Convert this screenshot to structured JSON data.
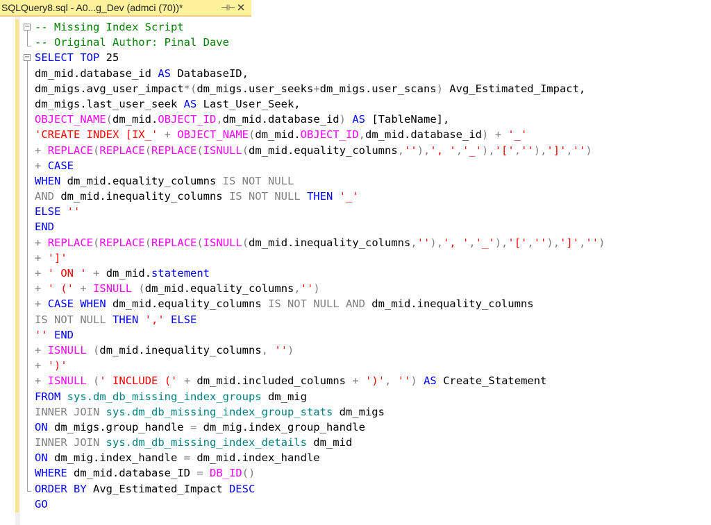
{
  "tab": {
    "title": "SQLQuery8.sql - A0...g_Dev (admci (70))*",
    "pin_icon": "pin-icon",
    "close_icon": "close-icon",
    "pin_glyph": "⊣⊢",
    "close_glyph": "✕"
  },
  "editor": {
    "fold_glyph": "−",
    "lines": [
      [
        {
          "c": "cm",
          "t": "-- Missing Index Script"
        }
      ],
      [
        {
          "c": "cm",
          "t": "-- Original Author: Pinal Dave"
        }
      ],
      [
        {
          "c": "kw",
          "t": "SELECT TOP "
        },
        {
          "c": "pl",
          "t": "25"
        }
      ],
      [
        {
          "c": "pl",
          "t": "dm_mid.database_id "
        },
        {
          "c": "kw",
          "t": "AS"
        },
        {
          "c": "pl",
          "t": " DatabaseID,"
        }
      ],
      [
        {
          "c": "pl",
          "t": "dm_migs.avg_user_impact"
        },
        {
          "c": "gr",
          "t": "*("
        },
        {
          "c": "pl",
          "t": "dm_migs.user_seeks"
        },
        {
          "c": "gr",
          "t": "+"
        },
        {
          "c": "pl",
          "t": "dm_migs.user_scans"
        },
        {
          "c": "gr",
          "t": ")"
        },
        {
          "c": "pl",
          "t": " Avg_Estimated_Impact,"
        }
      ],
      [
        {
          "c": "pl",
          "t": "dm_migs.last_user_seek "
        },
        {
          "c": "kw",
          "t": "AS"
        },
        {
          "c": "pl",
          "t": " Last_User_Seek,"
        }
      ],
      [
        {
          "c": "fn",
          "t": "OBJECT_NAME"
        },
        {
          "c": "gr",
          "t": "("
        },
        {
          "c": "pl",
          "t": "dm_mid."
        },
        {
          "c": "fn",
          "t": "OBJECT_ID"
        },
        {
          "c": "gr",
          "t": ","
        },
        {
          "c": "pl",
          "t": "dm_mid.database_id"
        },
        {
          "c": "gr",
          "t": ")"
        },
        {
          "c": "pl",
          "t": " "
        },
        {
          "c": "kw",
          "t": "AS"
        },
        {
          "c": "pl",
          "t": " [TableName],"
        }
      ],
      [
        {
          "c": "st",
          "t": "'CREATE INDEX [IX_'"
        },
        {
          "c": "pl",
          "t": " "
        },
        {
          "c": "gr",
          "t": "+"
        },
        {
          "c": "pl",
          "t": " "
        },
        {
          "c": "fn",
          "t": "OBJECT_NAME"
        },
        {
          "c": "gr",
          "t": "("
        },
        {
          "c": "pl",
          "t": "dm_mid."
        },
        {
          "c": "fn",
          "t": "OBJECT_ID"
        },
        {
          "c": "gr",
          "t": ","
        },
        {
          "c": "pl",
          "t": "dm_mid.database_id"
        },
        {
          "c": "gr",
          "t": ")"
        },
        {
          "c": "pl",
          "t": " "
        },
        {
          "c": "gr",
          "t": "+"
        },
        {
          "c": "pl",
          "t": " "
        },
        {
          "c": "st",
          "t": "'_'"
        }
      ],
      [
        {
          "c": "gr",
          "t": "+"
        },
        {
          "c": "pl",
          "t": " "
        },
        {
          "c": "fn",
          "t": "REPLACE"
        },
        {
          "c": "gr",
          "t": "("
        },
        {
          "c": "fn",
          "t": "REPLACE"
        },
        {
          "c": "gr",
          "t": "("
        },
        {
          "c": "fn",
          "t": "REPLACE"
        },
        {
          "c": "gr",
          "t": "("
        },
        {
          "c": "fn",
          "t": "ISNULL"
        },
        {
          "c": "gr",
          "t": "("
        },
        {
          "c": "pl",
          "t": "dm_mid.equality_columns"
        },
        {
          "c": "gr",
          "t": ","
        },
        {
          "c": "st",
          "t": "''"
        },
        {
          "c": "gr",
          "t": "),"
        },
        {
          "c": "st",
          "t": "', '"
        },
        {
          "c": "gr",
          "t": ","
        },
        {
          "c": "st",
          "t": "'_'"
        },
        {
          "c": "gr",
          "t": "),"
        },
        {
          "c": "st",
          "t": "'['"
        },
        {
          "c": "gr",
          "t": ","
        },
        {
          "c": "st",
          "t": "''"
        },
        {
          "c": "gr",
          "t": "),"
        },
        {
          "c": "st",
          "t": "']'"
        },
        {
          "c": "gr",
          "t": ","
        },
        {
          "c": "st",
          "t": "''"
        },
        {
          "c": "gr",
          "t": ")"
        }
      ],
      [
        {
          "c": "gr",
          "t": "+"
        },
        {
          "c": "pl",
          "t": " "
        },
        {
          "c": "kw",
          "t": "CASE"
        }
      ],
      [
        {
          "c": "kw",
          "t": "WHEN"
        },
        {
          "c": "pl",
          "t": " dm_mid.equality_columns "
        },
        {
          "c": "gr",
          "t": "IS NOT NULL"
        }
      ],
      [
        {
          "c": "gr",
          "t": "AND"
        },
        {
          "c": "pl",
          "t": " dm_mid.inequality_columns "
        },
        {
          "c": "gr",
          "t": "IS NOT NULL"
        },
        {
          "c": "pl",
          "t": " "
        },
        {
          "c": "kw",
          "t": "THEN"
        },
        {
          "c": "pl",
          "t": " "
        },
        {
          "c": "st",
          "t": "'_'"
        }
      ],
      [
        {
          "c": "kw",
          "t": "ELSE"
        },
        {
          "c": "pl",
          "t": " "
        },
        {
          "c": "st",
          "t": "''"
        }
      ],
      [
        {
          "c": "kw",
          "t": "END"
        }
      ],
      [
        {
          "c": "gr",
          "t": "+"
        },
        {
          "c": "pl",
          "t": " "
        },
        {
          "c": "fn",
          "t": "REPLACE"
        },
        {
          "c": "gr",
          "t": "("
        },
        {
          "c": "fn",
          "t": "REPLACE"
        },
        {
          "c": "gr",
          "t": "("
        },
        {
          "c": "fn",
          "t": "REPLACE"
        },
        {
          "c": "gr",
          "t": "("
        },
        {
          "c": "fn",
          "t": "ISNULL"
        },
        {
          "c": "gr",
          "t": "("
        },
        {
          "c": "pl",
          "t": "dm_mid.inequality_columns"
        },
        {
          "c": "gr",
          "t": ","
        },
        {
          "c": "st",
          "t": "''"
        },
        {
          "c": "gr",
          "t": "),"
        },
        {
          "c": "st",
          "t": "', '"
        },
        {
          "c": "gr",
          "t": ","
        },
        {
          "c": "st",
          "t": "'_'"
        },
        {
          "c": "gr",
          "t": "),"
        },
        {
          "c": "st",
          "t": "'['"
        },
        {
          "c": "gr",
          "t": ","
        },
        {
          "c": "st",
          "t": "''"
        },
        {
          "c": "gr",
          "t": "),"
        },
        {
          "c": "st",
          "t": "']'"
        },
        {
          "c": "gr",
          "t": ","
        },
        {
          "c": "st",
          "t": "''"
        },
        {
          "c": "gr",
          "t": ")"
        }
      ],
      [
        {
          "c": "gr",
          "t": "+"
        },
        {
          "c": "pl",
          "t": " "
        },
        {
          "c": "st",
          "t": "']'"
        }
      ],
      [
        {
          "c": "gr",
          "t": "+"
        },
        {
          "c": "pl",
          "t": " "
        },
        {
          "c": "st",
          "t": "' ON '"
        },
        {
          "c": "pl",
          "t": " "
        },
        {
          "c": "gr",
          "t": "+"
        },
        {
          "c": "pl",
          "t": " dm_mid."
        },
        {
          "c": "kw",
          "t": "statement"
        }
      ],
      [
        {
          "c": "gr",
          "t": "+"
        },
        {
          "c": "pl",
          "t": " "
        },
        {
          "c": "st",
          "t": "' ('"
        },
        {
          "c": "pl",
          "t": " "
        },
        {
          "c": "gr",
          "t": "+"
        },
        {
          "c": "pl",
          "t": " "
        },
        {
          "c": "fn",
          "t": "ISNULL"
        },
        {
          "c": "pl",
          "t": " "
        },
        {
          "c": "gr",
          "t": "("
        },
        {
          "c": "pl",
          "t": "dm_mid.equality_columns"
        },
        {
          "c": "gr",
          "t": ","
        },
        {
          "c": "st",
          "t": "''"
        },
        {
          "c": "gr",
          "t": ")"
        }
      ],
      [
        {
          "c": "gr",
          "t": "+"
        },
        {
          "c": "pl",
          "t": " "
        },
        {
          "c": "kw",
          "t": "CASE WHEN"
        },
        {
          "c": "pl",
          "t": " dm_mid.equality_columns "
        },
        {
          "c": "gr",
          "t": "IS NOT NULL AND"
        },
        {
          "c": "pl",
          "t": " dm_mid.inequality_columns"
        }
      ],
      [
        {
          "c": "gr",
          "t": "IS NOT NULL"
        },
        {
          "c": "pl",
          "t": " "
        },
        {
          "c": "kw",
          "t": "THEN"
        },
        {
          "c": "pl",
          "t": " "
        },
        {
          "c": "st",
          "t": "','"
        },
        {
          "c": "pl",
          "t": " "
        },
        {
          "c": "kw",
          "t": "ELSE"
        }
      ],
      [
        {
          "c": "st",
          "t": "''"
        },
        {
          "c": "pl",
          "t": " "
        },
        {
          "c": "kw",
          "t": "END"
        }
      ],
      [
        {
          "c": "gr",
          "t": "+"
        },
        {
          "c": "pl",
          "t": " "
        },
        {
          "c": "fn",
          "t": "ISNULL"
        },
        {
          "c": "pl",
          "t": " "
        },
        {
          "c": "gr",
          "t": "("
        },
        {
          "c": "pl",
          "t": "dm_mid.inequality_columns"
        },
        {
          "c": "gr",
          "t": ","
        },
        {
          "c": "pl",
          "t": " "
        },
        {
          "c": "st",
          "t": "''"
        },
        {
          "c": "gr",
          "t": ")"
        }
      ],
      [
        {
          "c": "gr",
          "t": "+"
        },
        {
          "c": "pl",
          "t": " "
        },
        {
          "c": "st",
          "t": "')'"
        }
      ],
      [
        {
          "c": "gr",
          "t": "+"
        },
        {
          "c": "pl",
          "t": " "
        },
        {
          "c": "fn",
          "t": "ISNULL"
        },
        {
          "c": "pl",
          "t": " "
        },
        {
          "c": "gr",
          "t": "("
        },
        {
          "c": "st",
          "t": "' INCLUDE ('"
        },
        {
          "c": "pl",
          "t": " "
        },
        {
          "c": "gr",
          "t": "+"
        },
        {
          "c": "pl",
          "t": " dm_mid.included_columns "
        },
        {
          "c": "gr",
          "t": "+"
        },
        {
          "c": "pl",
          "t": " "
        },
        {
          "c": "st",
          "t": "')'"
        },
        {
          "c": "gr",
          "t": ","
        },
        {
          "c": "pl",
          "t": " "
        },
        {
          "c": "st",
          "t": "''"
        },
        {
          "c": "gr",
          "t": ")"
        },
        {
          "c": "pl",
          "t": " "
        },
        {
          "c": "kw",
          "t": "AS"
        },
        {
          "c": "pl",
          "t": " Create_Statement"
        }
      ],
      [
        {
          "c": "kw",
          "t": "FROM"
        },
        {
          "c": "pl",
          "t": " "
        },
        {
          "c": "sy",
          "t": "sys.dm_db_missing_index_groups"
        },
        {
          "c": "pl",
          "t": " dm_mig"
        }
      ],
      [
        {
          "c": "gr",
          "t": "INNER JOIN"
        },
        {
          "c": "pl",
          "t": " "
        },
        {
          "c": "sy",
          "t": "sys.dm_db_missing_index_group_stats"
        },
        {
          "c": "pl",
          "t": " dm_migs"
        }
      ],
      [
        {
          "c": "kw",
          "t": "ON"
        },
        {
          "c": "pl",
          "t": " dm_migs.group_handle "
        },
        {
          "c": "gr",
          "t": "="
        },
        {
          "c": "pl",
          "t": " dm_mig.index_group_handle"
        }
      ],
      [
        {
          "c": "gr",
          "t": "INNER JOIN"
        },
        {
          "c": "pl",
          "t": " "
        },
        {
          "c": "sy",
          "t": "sys.dm_db_missing_index_details"
        },
        {
          "c": "pl",
          "t": " dm_mid"
        }
      ],
      [
        {
          "c": "kw",
          "t": "ON"
        },
        {
          "c": "pl",
          "t": " dm_mig.index_handle "
        },
        {
          "c": "gr",
          "t": "="
        },
        {
          "c": "pl",
          "t": " dm_mid.index_handle"
        }
      ],
      [
        {
          "c": "kw",
          "t": "WHERE"
        },
        {
          "c": "pl",
          "t": " dm_mid.database_ID "
        },
        {
          "c": "gr",
          "t": "="
        },
        {
          "c": "pl",
          "t": " "
        },
        {
          "c": "fn",
          "t": "DB_ID"
        },
        {
          "c": "gr",
          "t": "()"
        }
      ],
      [
        {
          "c": "kw",
          "t": "ORDER BY"
        },
        {
          "c": "pl",
          "t": " Avg_Estimated_Impact "
        },
        {
          "c": "kw",
          "t": "DESC"
        }
      ],
      [
        {
          "c": "kw",
          "t": "GO"
        }
      ]
    ]
  }
}
